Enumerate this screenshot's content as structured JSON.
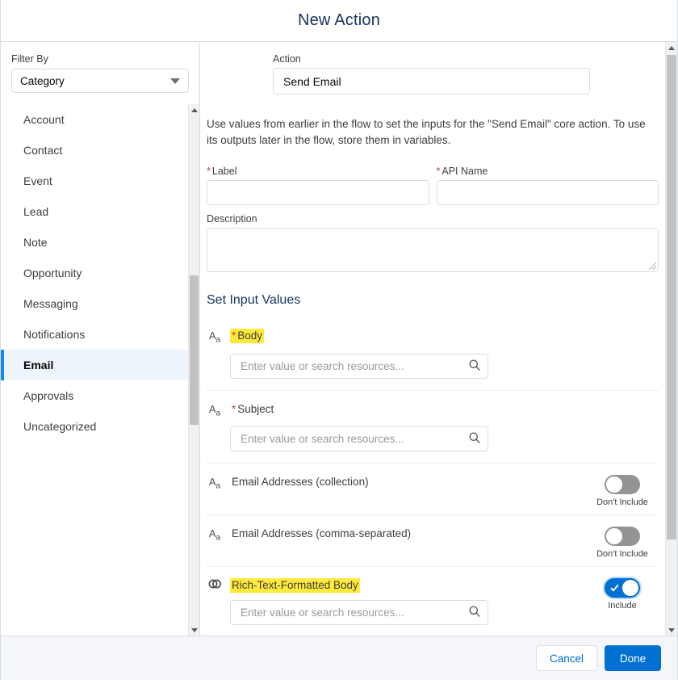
{
  "header": {
    "title": "New Action"
  },
  "sidebar": {
    "filter_label": "Filter By",
    "filter_value": "Category",
    "items": [
      {
        "label": "Account",
        "selected": false
      },
      {
        "label": "Contact",
        "selected": false
      },
      {
        "label": "Event",
        "selected": false
      },
      {
        "label": "Lead",
        "selected": false
      },
      {
        "label": "Note",
        "selected": false
      },
      {
        "label": "Opportunity",
        "selected": false
      },
      {
        "label": "Messaging",
        "selected": false
      },
      {
        "label": "Notifications",
        "selected": false
      },
      {
        "label": "Email",
        "selected": true
      },
      {
        "label": "Approvals",
        "selected": false
      },
      {
        "label": "Uncategorized",
        "selected": false
      }
    ]
  },
  "main": {
    "action": {
      "label": "Action",
      "value": "Send Email"
    },
    "help_text": "Use values from earlier in the flow to set the inputs for the \"Send Email\" core action. To use its outputs later in the flow, store them in variables.",
    "label_field": {
      "label": "Label",
      "required": "*",
      "value": "",
      "placeholder": ""
    },
    "api_name_field": {
      "label": "API Name",
      "required": "*",
      "value": "",
      "placeholder": ""
    },
    "description_field": {
      "label": "Description",
      "value": ""
    },
    "section_title": "Set Input Values",
    "input_placeholder": "Enter value or search resources...",
    "input_rows": [
      {
        "name": "Body",
        "required": "*",
        "datatype_icon": "text-aa-icon",
        "highlighted": true,
        "has_input": true,
        "has_toggle": false,
        "toggle_state": "",
        "toggle_label": ""
      },
      {
        "name": "Subject",
        "required": "*",
        "datatype_icon": "text-aa-icon",
        "highlighted": false,
        "has_input": true,
        "has_toggle": false,
        "toggle_state": "",
        "toggle_label": ""
      },
      {
        "name": "Email Addresses (collection)",
        "required": "",
        "datatype_icon": "text-aa-icon",
        "highlighted": false,
        "has_input": false,
        "has_toggle": true,
        "toggle_state": "off",
        "toggle_label": "Don't Include"
      },
      {
        "name": "Email Addresses (comma-separated)",
        "required": "",
        "datatype_icon": "text-aa-icon",
        "highlighted": false,
        "has_input": false,
        "has_toggle": true,
        "toggle_state": "off",
        "toggle_label": "Don't Include"
      },
      {
        "name": "Rich-Text-Formatted Body",
        "required": "",
        "datatype_icon": "boolean-icon",
        "highlighted": true,
        "has_input": true,
        "has_toggle": true,
        "toggle_state": "on",
        "toggle_label": "Include"
      }
    ]
  },
  "footer": {
    "cancel_label": "Cancel",
    "done_label": "Done"
  },
  "colors": {
    "brand_blue": "#0070d2",
    "accent_bar": "#1589ee",
    "selected_row_bg": "#eef4fb",
    "required_red": "#c23934",
    "highlight_yellow": "#ffe93b",
    "title_navy": "#16325c"
  }
}
